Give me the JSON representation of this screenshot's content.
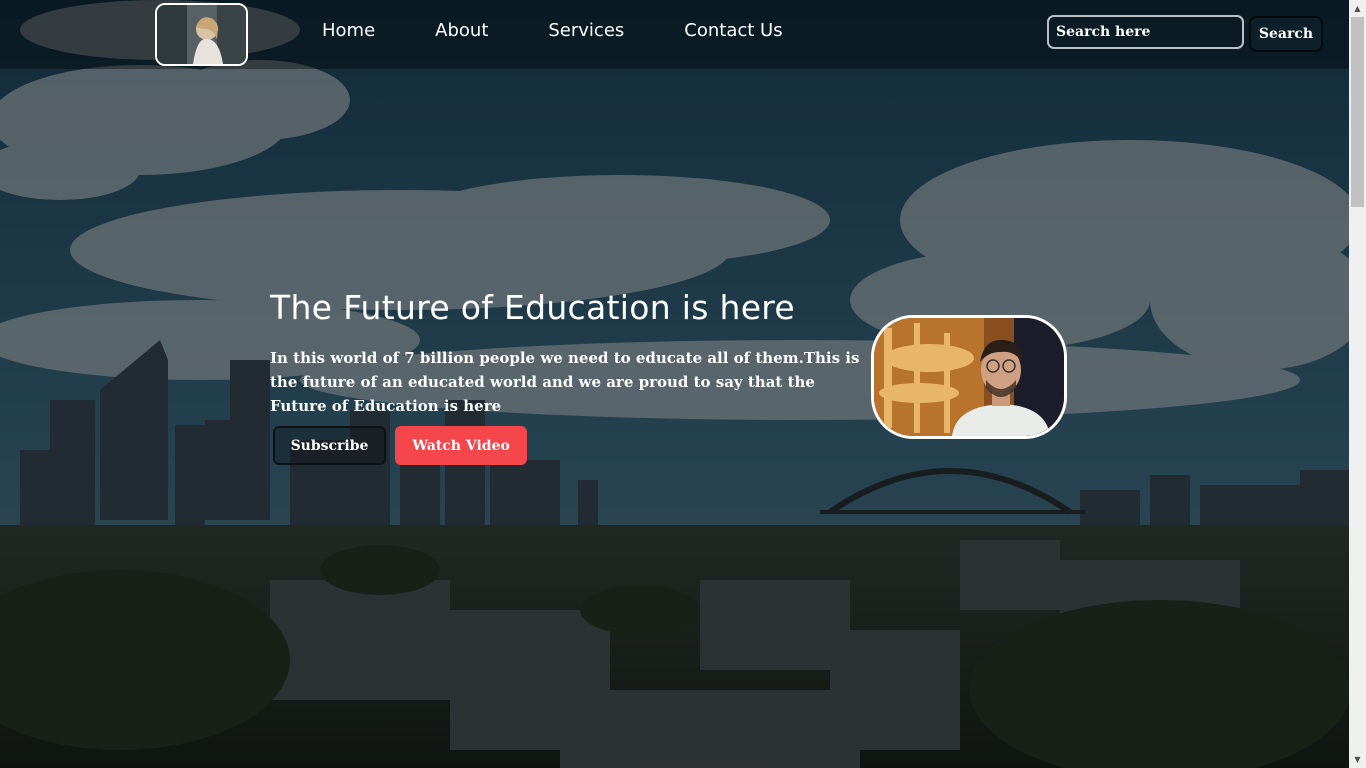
{
  "nav": {
    "links": [
      "Home",
      "About",
      "Services",
      "Contact Us"
    ],
    "search_placeholder": "Search here",
    "search_button": "Search"
  },
  "hero": {
    "title": "The Future of Education is here",
    "text": "In this world of 7 billion people we need to educate all of them.This is the future of an educated world and we are proud to say that the Future of Education is here",
    "subscribe_label": "Subscribe",
    "watch_label": "Watch Video"
  },
  "colors": {
    "accent": "#f5474b",
    "overlay": "rgba(0,0,0,0.42)",
    "sky": "#2b5a73"
  }
}
